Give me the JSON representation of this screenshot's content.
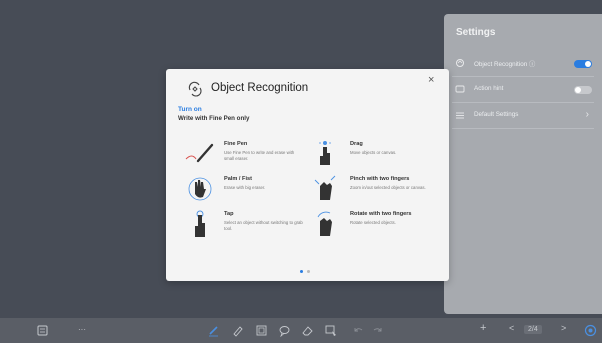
{
  "settings": {
    "title": "Settings",
    "items": [
      {
        "label": "Object Recognition ⓘ",
        "icon": "object-recognition-icon",
        "control": "toggle",
        "on": true
      },
      {
        "label": "Action hint",
        "icon": "action-hint-icon",
        "control": "toggle",
        "on": false
      },
      {
        "label": "Default Settings",
        "icon": "default-settings-icon",
        "control": "chevron"
      }
    ]
  },
  "dialog": {
    "title": "Object Recognition",
    "turn_on": "Turn on",
    "subtitle": "Write with Fine Pen only",
    "close_glyph": "×",
    "gestures": [
      {
        "title": "Fine Pen",
        "desc": "Use Fine Pen to write and erase with small eraser.",
        "icon": "fine-pen-icon"
      },
      {
        "title": "Drag",
        "desc": "Move objects or canvas.",
        "icon": "drag-hand-icon"
      },
      {
        "title": "Palm / Fist",
        "desc": "Erase with big eraser.",
        "icon": "palm-icon"
      },
      {
        "title": "Pinch with two fingers",
        "desc": "Zoom in/out selected objects or canvas.",
        "icon": "pinch-icon"
      },
      {
        "title": "Tap",
        "desc": "Select an object without switching to grab tool.",
        "icon": "tap-icon"
      },
      {
        "title": "Rotate with two fingers",
        "desc": "Rotate selected objects.",
        "icon": "rotate-icon"
      }
    ],
    "page_dots": {
      "count": 2,
      "active": 0
    }
  },
  "toolbar": {
    "more": "···",
    "page_indicator": "2/4",
    "prev": "<",
    "next": ">",
    "add": "+"
  },
  "colors": {
    "accent": "#2a7de1",
    "background": "#4d525c",
    "panel": "#a7aaaf",
    "dialog": "#f4f4f4"
  }
}
